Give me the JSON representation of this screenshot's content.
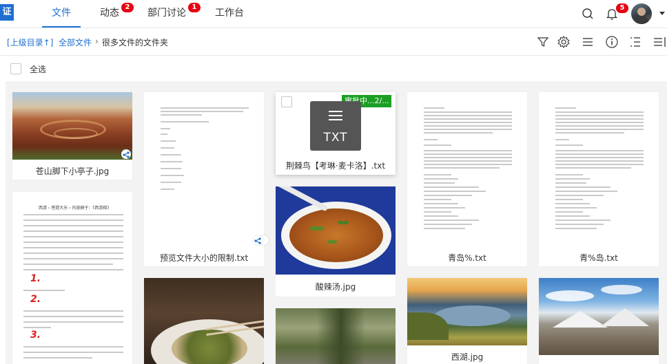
{
  "app": {
    "logo_text": "证",
    "tabs": [
      {
        "label": "文件",
        "badge": null
      },
      {
        "label": "动态",
        "badge": "2"
      },
      {
        "label": "部门讨论",
        "badge": "1"
      },
      {
        "label": "工作台",
        "badge": null
      }
    ],
    "notification_badge": "5",
    "accent_color": "#1e6fd1",
    "badge_color": "#e60012"
  },
  "breadcrumb": {
    "up_label": "[上级目录↑]",
    "root_label": "全部文件",
    "separator": "›",
    "current_label": "很多文件的文件夹"
  },
  "toolbar": {
    "icons": [
      "filter-icon",
      "settings-icon",
      "list-view-icon",
      "info-icon",
      "sort-icon",
      "columns-icon"
    ]
  },
  "select_all_label": "全选",
  "files": [
    {
      "name": "苍山脚下小亭子.jpg"
    },
    {
      "name": "预览文件大小的限制.txt"
    },
    {
      "name": "荆棘鸟【考琳·麦卡洛】.txt",
      "status": "审批中...2/...",
      "type_label": "TXT"
    },
    {
      "name": "青岛%.txt"
    },
    {
      "name": "青%岛.txt"
    },
    {
      "name": "酸辣汤.jpg"
    },
    {
      "name": "西湖.jpg"
    },
    {
      "name": ""
    },
    {
      "name": ""
    },
    {
      "name": ""
    },
    {
      "name": ""
    }
  ],
  "doc_text": {
    "breadcrumb_line": "西游 › 菩提大乐 › 内容摘于：《西游释》",
    "numbers": [
      "1.",
      "2.",
      "3."
    ]
  }
}
